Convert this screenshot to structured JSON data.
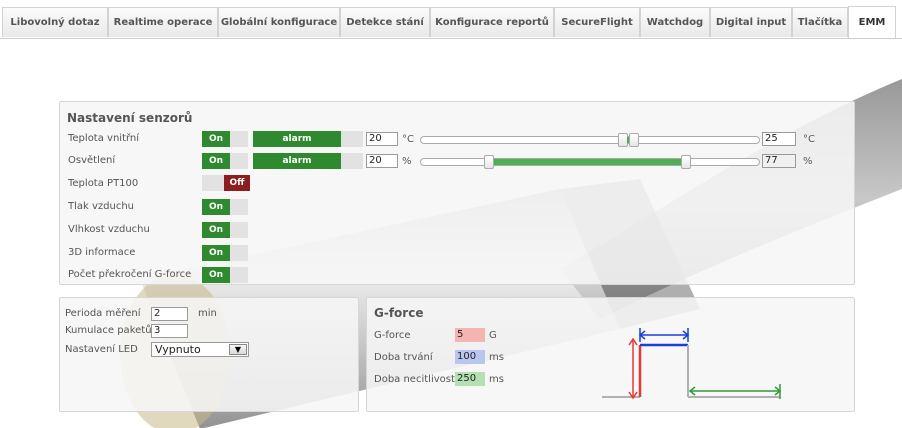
{
  "tabs": [
    {
      "label": "Libovolný dotaz"
    },
    {
      "label": "Realtime operace"
    },
    {
      "label": "Globální konfigurace"
    },
    {
      "label": "Detekce stání"
    },
    {
      "label": "Konfigurace reportů"
    },
    {
      "label": "SecureFlight"
    },
    {
      "label": "Watchdog"
    },
    {
      "label": "Digital input"
    },
    {
      "label": "Tlačítka"
    },
    {
      "label": "EMM",
      "active": true
    }
  ],
  "sensors": {
    "title": "Nastavení senzorů",
    "rows": [
      {
        "label": "Teplota vnitřní",
        "state": "On",
        "alarm": "alarm",
        "min": "20",
        "unit": "°C",
        "max": "25",
        "unit2": "°C"
      },
      {
        "label": "Osvětlení",
        "state": "On",
        "alarm": "alarm",
        "min": "20",
        "unit": "%",
        "max": "77",
        "unit2": "%"
      },
      {
        "label": "Teplota PT100",
        "state": "Off"
      },
      {
        "label": "Tlak vzduchu",
        "state": "On"
      },
      {
        "label": "Vlhkost vzduchu",
        "state": "On"
      },
      {
        "label": "3D informace",
        "state": "On"
      },
      {
        "label": "Počet překročení G-force",
        "state": "On"
      }
    ]
  },
  "sliders": [
    {
      "low_pct": 0.59,
      "high_pct": 0.62,
      "fill": false
    },
    {
      "low_pct": 0.2,
      "high_pct": 0.77,
      "fill": true
    }
  ],
  "settings": {
    "perioda_label": "Perioda měření",
    "perioda_value": "2",
    "perioda_unit": "min",
    "kumulace_label": "Kumulace paketů",
    "kumulace_value": "3",
    "led_label": "Nastavení LED",
    "led_value": "Vypnuto"
  },
  "gforce": {
    "title": "G-force",
    "rows": [
      {
        "label": "G-force",
        "value": "5",
        "unit": "G",
        "color": "#f4b4b4"
      },
      {
        "label": "Doba trvání",
        "value": "100",
        "unit": "ms",
        "color": "#b9c6f0"
      },
      {
        "label": "Doba necitlivosti",
        "value": "250",
        "unit": "ms",
        "color": "#b4e0b4"
      }
    ]
  },
  "colors": {
    "on": "#2f8a2f",
    "off": "#8b1f1f",
    "red": "#e53935",
    "blue": "#1e3fd6",
    "green": "#2e9b3a"
  }
}
